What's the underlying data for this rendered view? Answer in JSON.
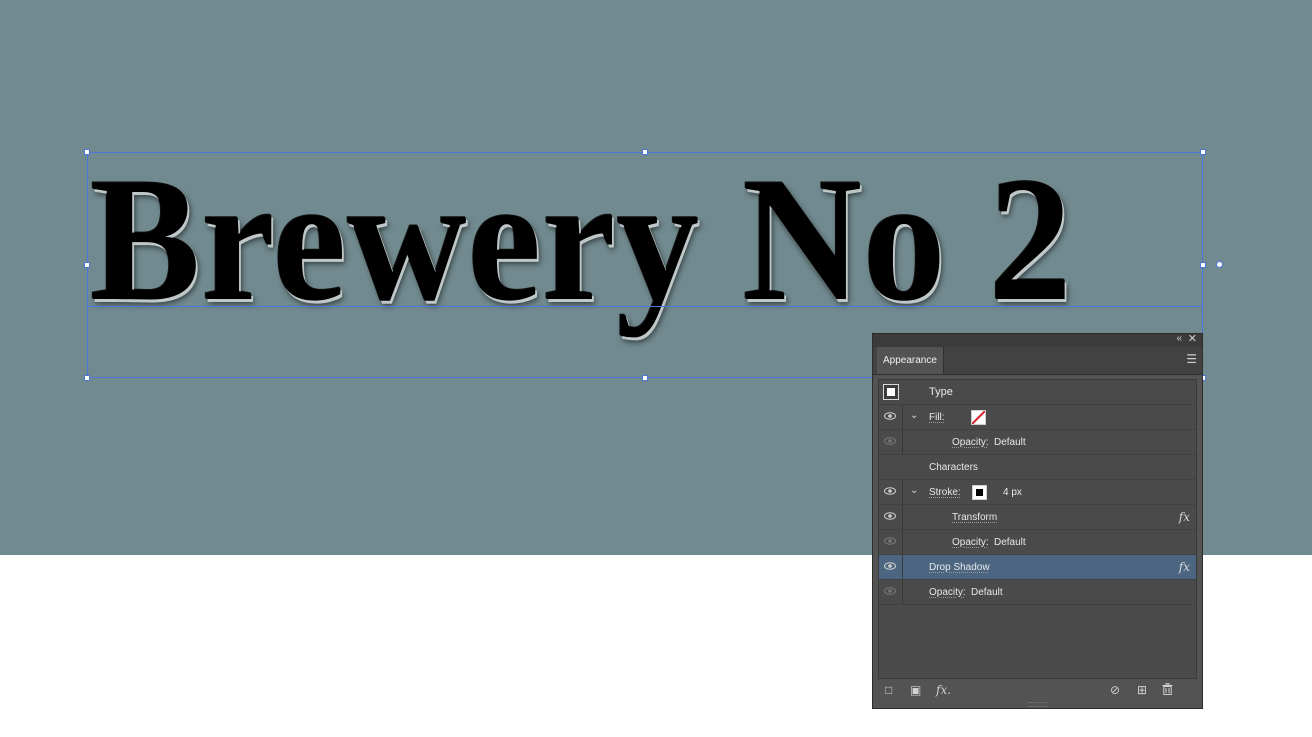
{
  "artwork": {
    "text": "Brewery No 2"
  },
  "panel": {
    "tab": "Appearance",
    "collapse_icon": "double-chevron-left-icon",
    "close_icon": "close-icon",
    "menu_icon": "hamburger-menu-icon",
    "rows": {
      "type": {
        "label": "Type"
      },
      "fill": {
        "label": "Fill:",
        "swatch": "none-red-slash",
        "opacity_label": "Opacity:",
        "opacity_value": "Default"
      },
      "characters": {
        "label": "Characters"
      },
      "stroke": {
        "label": "Stroke:",
        "width": "4 px",
        "swatch": "black"
      },
      "transform": {
        "label": "Transform",
        "fx": "fx"
      },
      "stroke_opacity": {
        "label": "Opacity:",
        "value": "Default"
      },
      "drop_shadow": {
        "label": "Drop Shadow",
        "fx": "fx"
      },
      "opacity": {
        "label": "Opacity:",
        "value": "Default"
      }
    },
    "footer": {
      "add_stroke_icon": "square-outline-icon",
      "add_fill_icon": "square-filled-icon",
      "fx_label": "fx.",
      "clear_icon": "no-sign-icon",
      "duplicate_icon": "plus-square-icon",
      "delete_icon": "trash-icon"
    }
  },
  "colors": {
    "canvas": "#718a8f",
    "selection": "#4b78d8",
    "panel_bg": "#535353",
    "selected_row": "#4c6682"
  }
}
